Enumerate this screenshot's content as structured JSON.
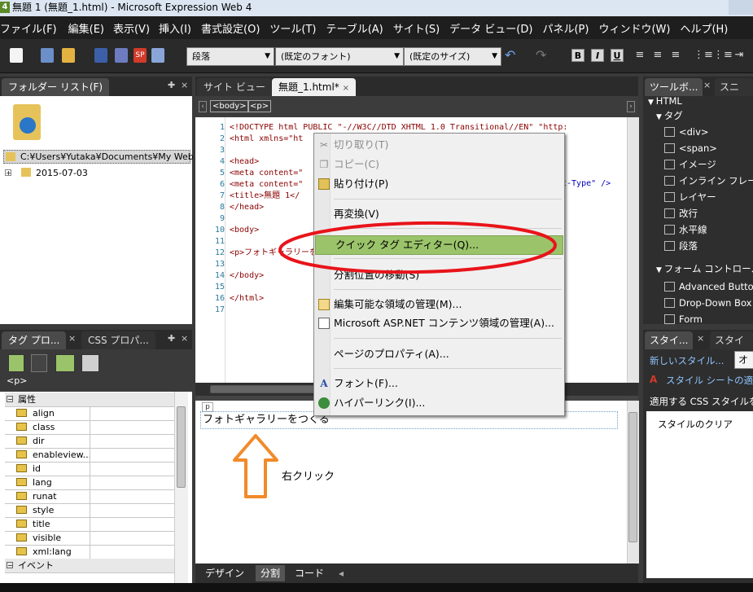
{
  "window": {
    "title": "無題 1 (無題_1.html) - Microsoft Expression Web 4",
    "app_icon": "4"
  },
  "menu": [
    "ファイル(F)",
    "編集(E)",
    "表示(V)",
    "挿入(I)",
    "書式設定(O)",
    "ツール(T)",
    "テーブル(A)",
    "サイト(S)",
    "データ ビュー(D)",
    "パネル(P)",
    "ウィンドウ(W)",
    "ヘルプ(H)"
  ],
  "toolbar": {
    "paragraph_style": "段落",
    "font": "(既定のフォント)",
    "font_size": "(既定のサイズ)",
    "bold": "B",
    "italic": "I",
    "underline": "U"
  },
  "folder_panel": {
    "tab": "フォルダー リスト(F)",
    "path": "C:¥Users¥Yutaka¥Documents¥My Web S",
    "folder": "2015-07-03"
  },
  "tag_panel": {
    "tabs": [
      "タグ プロ...",
      "CSS プロパ..."
    ],
    "current_tag": "<p>",
    "section_attributes": "属性",
    "attributes": [
      "align",
      "class",
      "dir",
      "enableview...",
      "id",
      "lang",
      "runat",
      "style",
      "title",
      "visible",
      "xml:lang"
    ],
    "section_events": "イベント"
  },
  "editor": {
    "tabs": [
      "サイト ビュー",
      "無題_1.html*"
    ],
    "breadcrumb": [
      "<body>",
      "<p>"
    ],
    "code_lines": [
      {
        "n": "1",
        "text": "<!DOCTYPE html PUBLIC \"-//W3C//DTD XHTML 1.0 Transitional//EN\" \"http:"
      },
      {
        "n": "2",
        "text": "<html xmlns=\"ht"
      },
      {
        "n": "3",
        "text": ""
      },
      {
        "n": "4",
        "text": "<head>"
      },
      {
        "n": "5",
        "text": "<meta content=\""
      },
      {
        "n": "6",
        "text": "<meta content=\""
      },
      {
        "n": "7",
        "text": "<title>無題 1</"
      },
      {
        "n": "8",
        "text": "</head>"
      },
      {
        "n": "9",
        "text": ""
      },
      {
        "n": "10",
        "text": "<body>"
      },
      {
        "n": "11",
        "text": ""
      },
      {
        "n": "12",
        "text": "<p>フォトギャラリーをつ"
      },
      {
        "n": "13",
        "text": ""
      },
      {
        "n": "14",
        "text": "</body>"
      },
      {
        "n": "15",
        "text": ""
      },
      {
        "n": "16",
        "text": "</html>"
      },
      {
        "n": "17",
        "text": ""
      }
    ],
    "code_fragment_right": "t-Type\" />",
    "design_tag": "p",
    "design_text": "フォトギャラリーをつくる",
    "annotation": "右クリック",
    "view_tabs": [
      "デザイン",
      "分割",
      "コード"
    ]
  },
  "context_menu": {
    "items": [
      {
        "label": "切り取り(T)",
        "disabled": true,
        "icon": "scissors-icon"
      },
      {
        "label": "コピー(C)",
        "disabled": true,
        "icon": "copy-icon"
      },
      {
        "label": "貼り付け(P)",
        "disabled": false,
        "icon": "paste-icon"
      },
      {
        "label": "再変換(V)",
        "disabled": false,
        "icon": ""
      },
      {
        "label": "クイック タグ エディター(Q)...",
        "disabled": false,
        "icon": "",
        "highlighted": true
      },
      {
        "label": "分割位置の移動(S)",
        "disabled": false,
        "icon": ""
      },
      {
        "label": "編集可能な領域の管理(M)...",
        "disabled": false,
        "icon": "region-icon"
      },
      {
        "label": "Microsoft ASP.NET コンテンツ領域の管理(A)...",
        "disabled": false,
        "icon": "aspnet-icon"
      },
      {
        "label": "ページのプロパティ(A)...",
        "disabled": false,
        "icon": ""
      },
      {
        "label": "フォント(F)...",
        "disabled": false,
        "icon": "font-icon"
      },
      {
        "label": "ハイパーリンク(I)...",
        "disabled": false,
        "icon": "hyperlink-icon"
      }
    ]
  },
  "toolbox": {
    "tabs": [
      "ツールボ...",
      "スニペ"
    ],
    "html": "HTML",
    "tags_group": "タグ",
    "tags": [
      "<div>",
      "<span>",
      "イメージ",
      "インライン フレーム",
      "レイヤー",
      "改行",
      "水平線",
      "段落"
    ],
    "form_group": "フォーム コントロール",
    "forms": [
      "Advanced Button",
      "Drop-Down Box",
      "Form"
    ]
  },
  "style_panel": {
    "tabs": [
      "スタイ...",
      "スタイル"
    ],
    "new_style": "新しいスタイル...",
    "option_btn": "オ",
    "attach": "スタイル シートの適用",
    "apply_label": "適用する CSS スタイルを選",
    "clear": "スタイルのクリア"
  },
  "colors": {
    "highlight": "#9bc46a",
    "ellipse": "#e8141a",
    "arrow": "#f28a2a"
  }
}
